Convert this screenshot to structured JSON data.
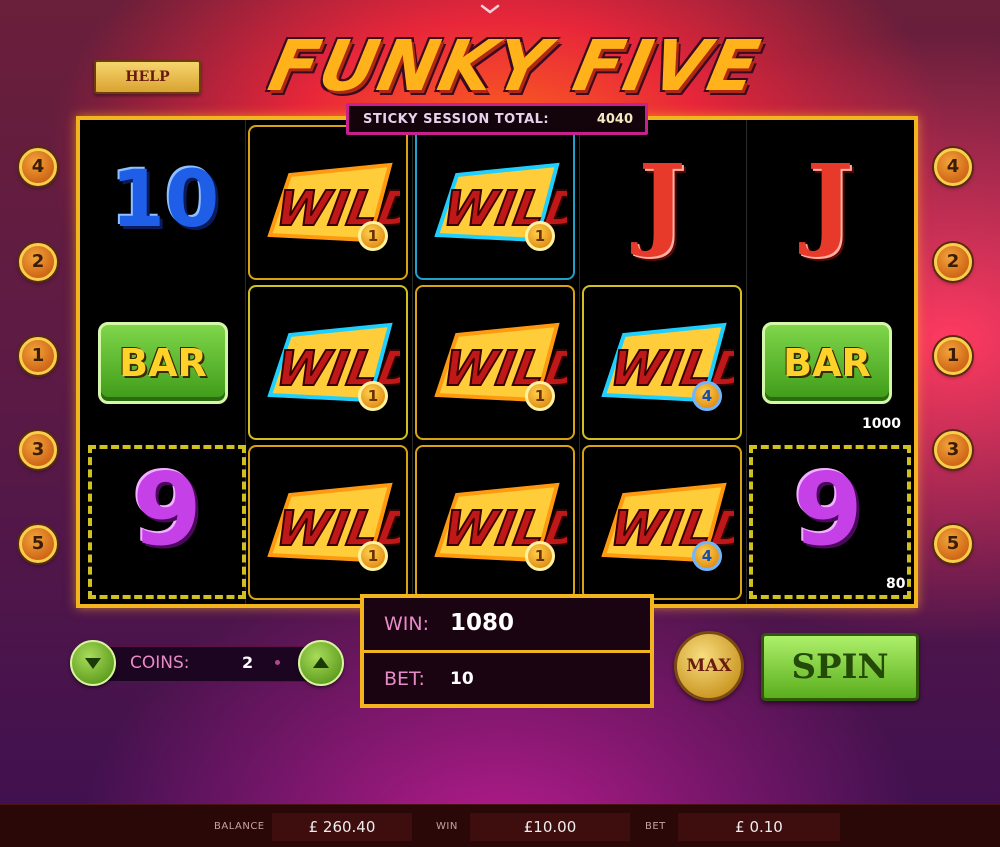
{
  "game": {
    "title": "FUNKY FIVE",
    "help_label": "HELP",
    "sticky_label": "STICKY SESSION TOTAL:",
    "sticky_value": "4040"
  },
  "paylines": {
    "left": [
      "4",
      "2",
      "1",
      "3",
      "5"
    ],
    "right": [
      "4",
      "2",
      "1",
      "3",
      "5"
    ]
  },
  "reels": {
    "symbols": {
      "ten": "10",
      "jack": "J",
      "bar": "BAR",
      "nine": "9",
      "wild": "WILD"
    },
    "wild_multipliers": {
      "r2_top": "1",
      "r3_top": "1",
      "r2_mid": "1",
      "r3_mid": "1",
      "r4_mid": "4",
      "r2_bot": "1",
      "r3_bot": "1",
      "r4_bot": "4"
    },
    "line_wins": {
      "mid": "1000",
      "bot": "80"
    }
  },
  "controls": {
    "coins_label": "COINS:",
    "coins_value": "2",
    "win_label": "WIN:",
    "win_value": "1080",
    "bet_label": "BET:",
    "bet_value": "10",
    "max_label": "MAX",
    "spin_label": "SPIN"
  },
  "footer": {
    "balance_label": "BALANCE",
    "balance_value": "£ 260.40",
    "win_label": "WIN",
    "win_value": "£10.00",
    "bet_label": "BET",
    "bet_value": "£ 0.10"
  },
  "colors": {
    "frame_gold": "#f3b51e",
    "title_orange": "#ffb21a",
    "spin_green": "#5aae1e",
    "label_pink": "#e88ac8"
  }
}
